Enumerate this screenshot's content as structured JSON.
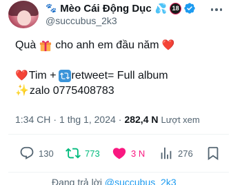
{
  "author": {
    "display_name": "Mèo Cái Động Dục",
    "handle": "@succubus_2k3",
    "name_emoji_prefix": "🐾",
    "name_emoji_suffix": "💦",
    "age_badge": "18",
    "verified": true
  },
  "tweet": {
    "line1_before": "Quà",
    "line1_after": "cho anh em đầu năm",
    "line2_before": "Tim +",
    "line2_after": "retweet= Full album",
    "line3_text": "zalo 0775408783"
  },
  "meta": {
    "time": "1:34 CH",
    "separator": "·",
    "date": "1 thg 1, 2024",
    "views_count": "282,4 N",
    "views_label": "Lượt xem"
  },
  "actions": {
    "replies": "130",
    "retweets": "773",
    "likes": "3 N",
    "views": "276"
  },
  "reply_context": {
    "label": "Đang trả lời",
    "mention": "@succubus_2k3"
  },
  "colors": {
    "text": "#0f1419",
    "secondary": "#536471",
    "retweet_active": "#00ba7c",
    "like_active": "#f91880",
    "link": "#1d9bf0",
    "verified": "#1d9bf0"
  },
  "icons": [
    "paw-icon",
    "droplets-icon",
    "age-18-badge-icon",
    "verified-icon",
    "more-icon",
    "gift-icon",
    "heart-icon",
    "retweet-emoji-icon",
    "sparkles-icon",
    "reply-icon",
    "retweet-icon",
    "like-icon",
    "views-icon",
    "bookmark-icon"
  ]
}
